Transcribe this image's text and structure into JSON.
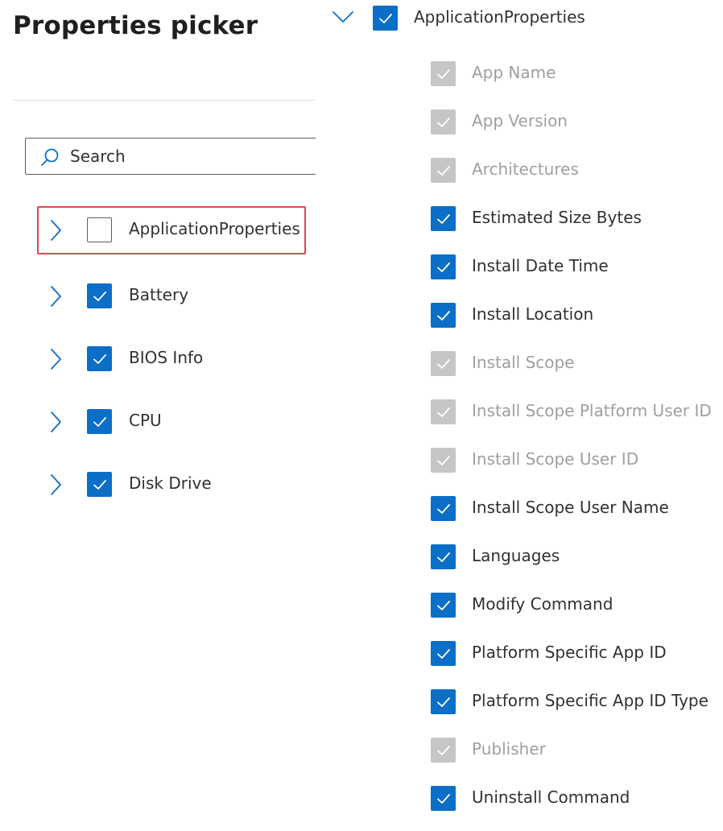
{
  "left_panel": {
    "title": "Properties picker",
    "search": {
      "placeholder": "Search",
      "icon": "search-icon"
    },
    "tree": [
      {
        "label": "ApplicationProperties",
        "checked": false,
        "highlighted": true
      },
      {
        "label": "Battery",
        "checked": true,
        "highlighted": false
      },
      {
        "label": "BIOS Info",
        "checked": true,
        "highlighted": false
      },
      {
        "label": "CPU",
        "checked": true,
        "highlighted": false
      },
      {
        "label": "Disk Drive",
        "checked": true,
        "highlighted": false
      }
    ]
  },
  "right_panel": {
    "group": {
      "label": "ApplicationProperties",
      "checked": true,
      "expanded": true
    },
    "properties": [
      {
        "label": "App Name",
        "state": "disabled"
      },
      {
        "label": "App Version",
        "state": "disabled"
      },
      {
        "label": "Architectures",
        "state": "disabled"
      },
      {
        "label": "Estimated Size Bytes",
        "state": "checked"
      },
      {
        "label": "Install Date Time",
        "state": "checked"
      },
      {
        "label": "Install Location",
        "state": "checked"
      },
      {
        "label": "Install Scope",
        "state": "disabled"
      },
      {
        "label": "Install Scope Platform User ID",
        "state": "disabled"
      },
      {
        "label": "Install Scope User ID",
        "state": "disabled"
      },
      {
        "label": "Install Scope User Name",
        "state": "checked"
      },
      {
        "label": "Languages",
        "state": "checked"
      },
      {
        "label": "Modify Command",
        "state": "checked"
      },
      {
        "label": "Platform Specific App ID",
        "state": "checked"
      },
      {
        "label": "Platform Specific App ID Type",
        "state": "checked"
      },
      {
        "label": "Publisher",
        "state": "disabled"
      },
      {
        "label": "Uninstall Command",
        "state": "checked"
      }
    ]
  },
  "colors": {
    "checkbox_checked": "#0b6fc8",
    "checkbox_disabled": "#c8c6c4",
    "chevron": "#0b6fc8",
    "highlight_border": "#e0464f",
    "text": "#323130",
    "text_disabled": "#a19f9d"
  }
}
